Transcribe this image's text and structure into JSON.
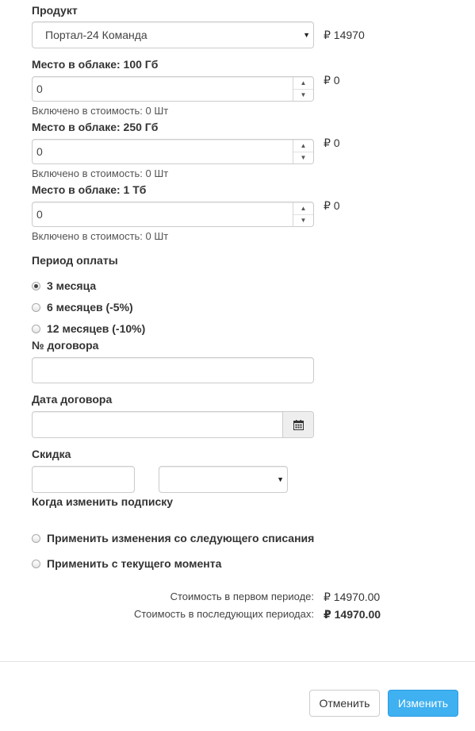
{
  "product": {
    "label": "Продукт",
    "selected": "Портал-24 Команда",
    "price": "₽ 14970"
  },
  "storage": [
    {
      "label": "Место в облаке: 100 Гб",
      "value": "0",
      "price": "₽ 0",
      "included": "Включено в стоимость: 0 Шт"
    },
    {
      "label": "Место в облаке: 250 Гб",
      "value": "0",
      "price": "₽ 0",
      "included": "Включено в стоимость: 0 Шт"
    },
    {
      "label": "Место в облаке: 1 Тб",
      "value": "0",
      "price": "₽ 0",
      "included": "Включено в стоимость: 0 Шт"
    }
  ],
  "payment_period": {
    "label": "Период оплаты",
    "options": [
      {
        "label": "3 месяца",
        "checked": true
      },
      {
        "label": "6 месяцев (-5%)",
        "checked": false
      },
      {
        "label": "12 месяцев (-10%)",
        "checked": false
      }
    ]
  },
  "contract_number": {
    "label": "№ договора",
    "value": ""
  },
  "contract_date": {
    "label": "Дата договора",
    "value": "",
    "icon": "calendar-icon"
  },
  "discount": {
    "label": "Скидка",
    "value": "",
    "type_value": ""
  },
  "when_change": {
    "label": "Когда изменить подписку",
    "options": [
      {
        "label": "Применить изменения со следующего списания",
        "checked": false
      },
      {
        "label": "Применить с текущего момента",
        "checked": false
      }
    ]
  },
  "summary": {
    "first_period_label": "Стоимость в первом периоде:",
    "first_period_value": "₽ 14970.00",
    "next_periods_label": "Стоимость в последующих периодах:",
    "next_periods_value": "₽ 14970.00"
  },
  "footer": {
    "cancel_label": "Отменить",
    "submit_label": "Изменить"
  },
  "colors": {
    "primary": "#3fb0f0",
    "border": "#cccccc"
  }
}
